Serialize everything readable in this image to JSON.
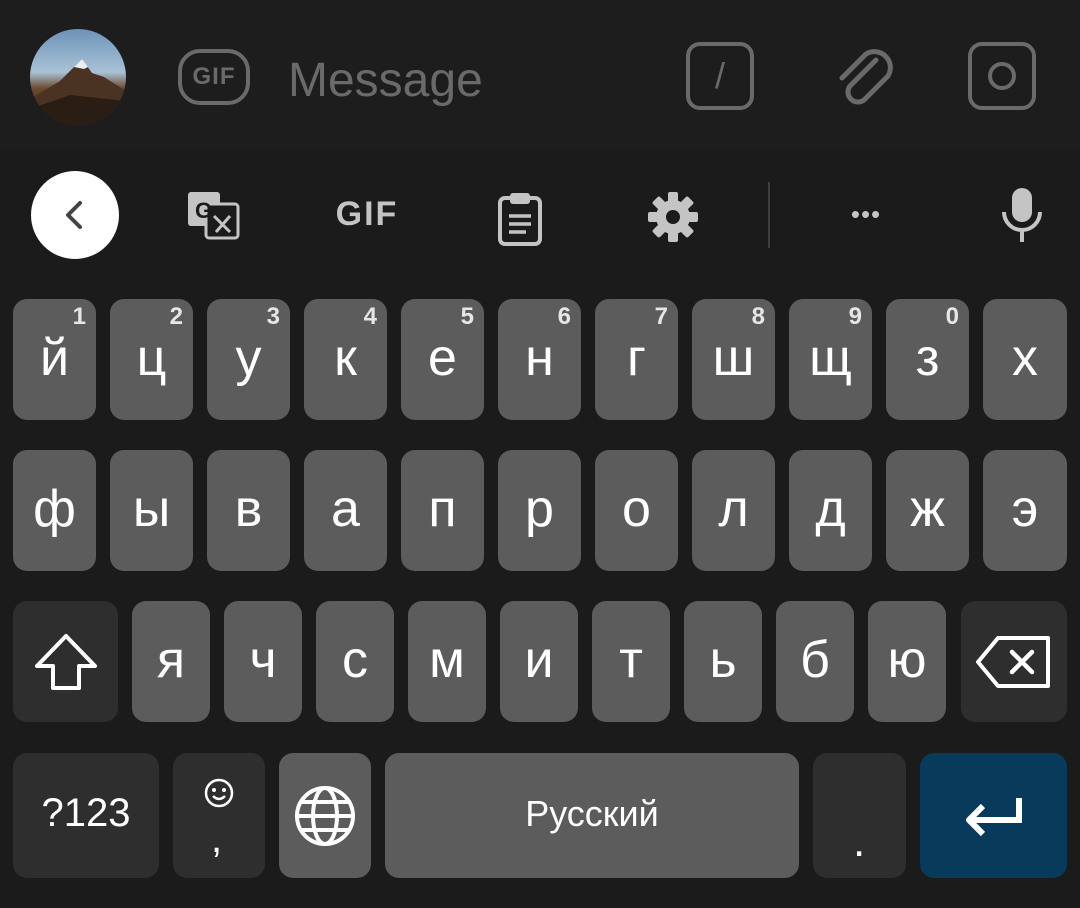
{
  "message_bar": {
    "gif_label": "GIF",
    "input_placeholder": "Message",
    "slash_label": "/"
  },
  "toolbar": {
    "gif_label": "GIF",
    "more_label": "•••"
  },
  "keyboard": {
    "row1": [
      {
        "key": "й",
        "hint": "1"
      },
      {
        "key": "ц",
        "hint": "2"
      },
      {
        "key": "у",
        "hint": "3"
      },
      {
        "key": "к",
        "hint": "4"
      },
      {
        "key": "е",
        "hint": "5"
      },
      {
        "key": "н",
        "hint": "6"
      },
      {
        "key": "г",
        "hint": "7"
      },
      {
        "key": "ш",
        "hint": "8"
      },
      {
        "key": "щ",
        "hint": "9"
      },
      {
        "key": "з",
        "hint": "0"
      },
      {
        "key": "х",
        "hint": ""
      }
    ],
    "row2": [
      "ф",
      "ы",
      "в",
      "а",
      "п",
      "р",
      "о",
      "л",
      "д",
      "ж",
      "э"
    ],
    "row3": [
      "я",
      "ч",
      "с",
      "м",
      "и",
      "т",
      "ь",
      "б",
      "ю"
    ],
    "bottom": {
      "symbols_label": "?123",
      "comma_label": ",",
      "space_label": "Русский",
      "period_label": "."
    }
  },
  "colors": {
    "key_bg": "#5c5c5c",
    "special_key_bg": "#2e2e2e",
    "enter_bg": "#083a5c",
    "background": "#1b1b1b"
  }
}
